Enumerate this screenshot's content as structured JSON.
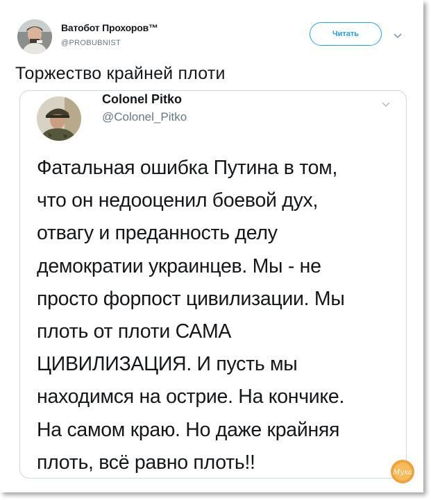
{
  "tweet": {
    "author_name": "Ватобот Прохоров™",
    "author_handle": "@PROBUBNIST",
    "follow_label": "Читать",
    "text": "Торжество крайней плоти"
  },
  "quoted_tweet": {
    "author_name": "Colonel Pitko",
    "author_handle": "@Colonel_Pitko",
    "lines": [
      "Фатальная ошибка Путина в том,",
      "что он недооценил боевой дух,",
      "отвагу и преданность делу",
      "демократии украинцев. Мы - не",
      "просто форпост цивилизации. Мы",
      "плоть от плоти САМА",
      "ЦИВИЛИЗАЦИЯ. И пусть мы",
      "находимся на острие. На кончике.",
      "На самом краю. Но даже крайняя",
      "плоть, всё равно плоть!!"
    ]
  },
  "watermark": {
    "text": "Муха",
    "color": "#f0a33a"
  },
  "icons": {
    "header_chevron": "chevron-down-icon",
    "quote_chevron": "chevron-down-icon"
  },
  "colors": {
    "accent": "#1da1f2",
    "secondary_text": "#657786",
    "border": "#ccd6dd"
  }
}
